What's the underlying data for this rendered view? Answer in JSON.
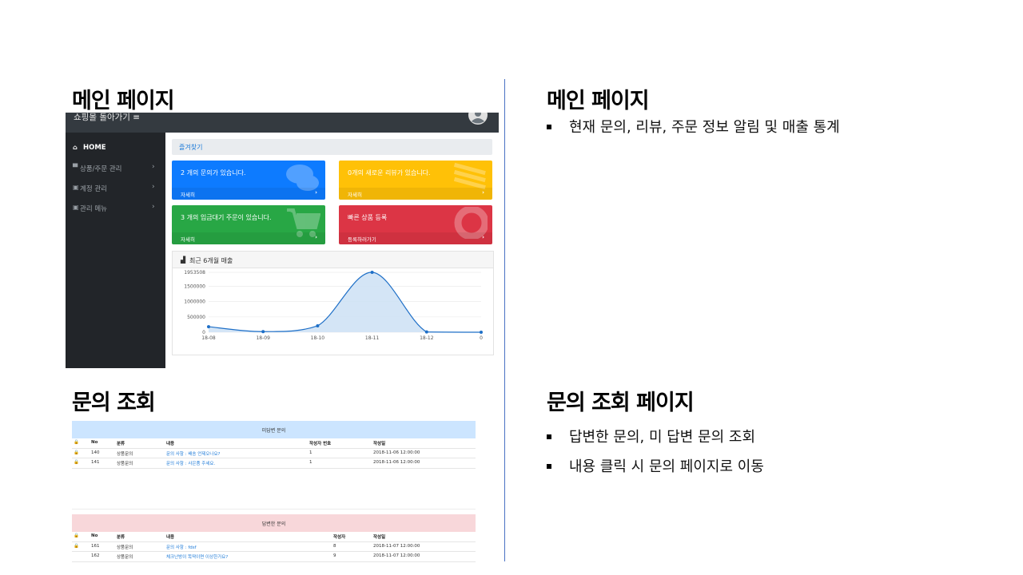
{
  "left_main_heading": "메인 페이지",
  "left_inquiry_heading": "문의 조회",
  "right_main_heading": "메인 페이지",
  "right_main_bullets": [
    "현재 문의, 리뷰, 주문 정보 알림 및 매출 통계"
  ],
  "right_inquiry_heading": "문의 조회 페이지",
  "right_inquiry_bullets": [
    "답변한 문의, 미 답변 문의 조회",
    "내용 클릭 시 문의 페이지로 이동"
  ],
  "dashboard": {
    "brand": "쇼핑몰 돌아가기 ≡",
    "avatar_icon": "user-circle-icon",
    "sidebar": [
      {
        "label": "HOME",
        "icon": "home-icon",
        "glyph": "⌂"
      },
      {
        "label": "상품/주문 관리",
        "icon": "cart-icon",
        "glyph": "▀"
      },
      {
        "label": "계정 관리",
        "icon": "clipboard-icon",
        "glyph": "▣"
      },
      {
        "label": "관리 메뉴",
        "icon": "clipboard-icon",
        "glyph": "▣"
      }
    ],
    "chevron": "›",
    "breadcrumb": "즐겨찾기",
    "cards": [
      {
        "title": "2 개의 문의가 있습니다.",
        "link": "자세히",
        "color": "#0d7bff",
        "icon": "comments-icon"
      },
      {
        "title": "0개의 새로운 리뷰가 있습니다.",
        "link": "자세히",
        "color": "#ffc107",
        "icon": "list-icon"
      },
      {
        "title": "3 개의 입금대기 주문이 있습니다.",
        "link": "자세히",
        "color": "#28a745",
        "icon": "shopping-cart-icon"
      },
      {
        "title": "빠른 상품 등록",
        "link": "등록하러가기",
        "color": "#dc3545",
        "icon": "life-ring-icon"
      }
    ],
    "card_arrow": "›",
    "chart_icon": "area-chart-icon",
    "chart_title": "최근 6개월 매출"
  },
  "chart_data": {
    "type": "area",
    "title": "최근 6개월 매출",
    "x": [
      "18-08",
      "18-09",
      "18-10",
      "18-11",
      "18-12",
      "0"
    ],
    "series": [
      {
        "values": [
          180000,
          20000,
          210000,
          1953508,
          10000,
          0
        ]
      }
    ],
    "yticks": [
      "0",
      "500000",
      "1000000",
      "1500000",
      "1953508"
    ],
    "ylim": [
      0,
      1953508
    ],
    "line_color": "#1e6fc7",
    "fill_color": "#cfe2f5",
    "grid": true
  },
  "unanswered": {
    "title": "미답변 문의",
    "header_color": "#cce5ff",
    "columns": [
      "No",
      "분류",
      "내용",
      "작성자 번호",
      "작성일"
    ],
    "rows": [
      {
        "no": "140",
        "category": "상품문의",
        "content": "문의 사항 : 배송 언제오나요?",
        "writer": "1",
        "date": "2018-11-06 12:00:00",
        "locked": true
      },
      {
        "no": "141",
        "category": "상품문의",
        "content": "문의 사항 : 사은품 주세요.",
        "writer": "1",
        "date": "2018-11-06 12:00:00",
        "locked": true
      }
    ]
  },
  "answered": {
    "title": "답변한 문의",
    "header_color": "#f8d7da",
    "columns": [
      "No",
      "분류",
      "내용",
      "작성자",
      "작성일"
    ],
    "rows": [
      {
        "no": "161",
        "category": "상품문의",
        "content": "문의 사항 : fdsf",
        "writer": "8",
        "date": "2018-11-07 12:00:00",
        "locked": true
      },
      {
        "no": "162",
        "category": "상품문의",
        "content": "체크난방이 똑딱이면 이상한가요?",
        "writer": "9",
        "date": "2018-11-07 12:00:00",
        "locked": false
      }
    ]
  }
}
